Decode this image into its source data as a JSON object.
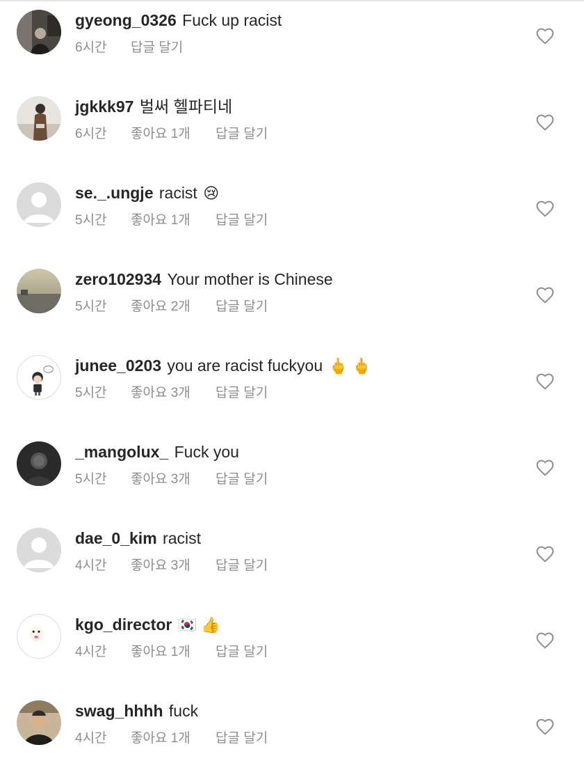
{
  "comments": [
    {
      "username": "gyeong_0326",
      "text": "Fuck up racist",
      "emoji": "",
      "time": "6시간",
      "likes": "",
      "reply": "답글 달기",
      "avatar": "photo-dark"
    },
    {
      "username": "jgkkk97",
      "text": "벌써 헬파티네",
      "emoji": "",
      "time": "6시간",
      "likes": "좋아요 1개",
      "reply": "답글 달기",
      "avatar": "photo-person"
    },
    {
      "username": "se._.ungje",
      "text": "racist",
      "emoji": "😢",
      "time": "5시간",
      "likes": "좋아요 1개",
      "reply": "답글 달기",
      "avatar": "default"
    },
    {
      "username": "zero102934",
      "text": "Your mother is Chinese",
      "emoji": "",
      "time": "5시간",
      "likes": "좋아요 2개",
      "reply": "답글 달기",
      "avatar": "photo-landscape"
    },
    {
      "username": "junee_0203",
      "text": "you are racist  fuckyou",
      "emoji": "🖕 🖕",
      "time": "5시간",
      "likes": "좋아요 3개",
      "reply": "답글 달기",
      "avatar": "cartoon"
    },
    {
      "username": "_mangolux_",
      "text": "Fuck you",
      "emoji": "",
      "time": "5시간",
      "likes": "좋아요 3개",
      "reply": "답글 달기",
      "avatar": "photo-dark2"
    },
    {
      "username": "dae_0_kim",
      "text": "racist",
      "emoji": "",
      "time": "4시간",
      "likes": "좋아요 3개",
      "reply": "답글 달기",
      "avatar": "default"
    },
    {
      "username": "kgo_director",
      "text": "",
      "emoji": "🇰🇷 👍",
      "time": "4시간",
      "likes": "좋아요 1개",
      "reply": "답글 달기",
      "avatar": "face-drawing"
    },
    {
      "username": "swag_hhhh",
      "text": "fuck",
      "emoji": "",
      "time": "4시간",
      "likes": "좋아요 1개",
      "reply": "답글 달기",
      "avatar": "photo-man"
    }
  ],
  "colors": {
    "username": "#262626",
    "meta": "#8e8e8e",
    "heart_outline": "#8e8e8e",
    "placeholder_avatar": "#dbdbdb"
  },
  "icons": {
    "like": "heart-outline-icon",
    "default_avatar": "user-silhouette-icon"
  }
}
